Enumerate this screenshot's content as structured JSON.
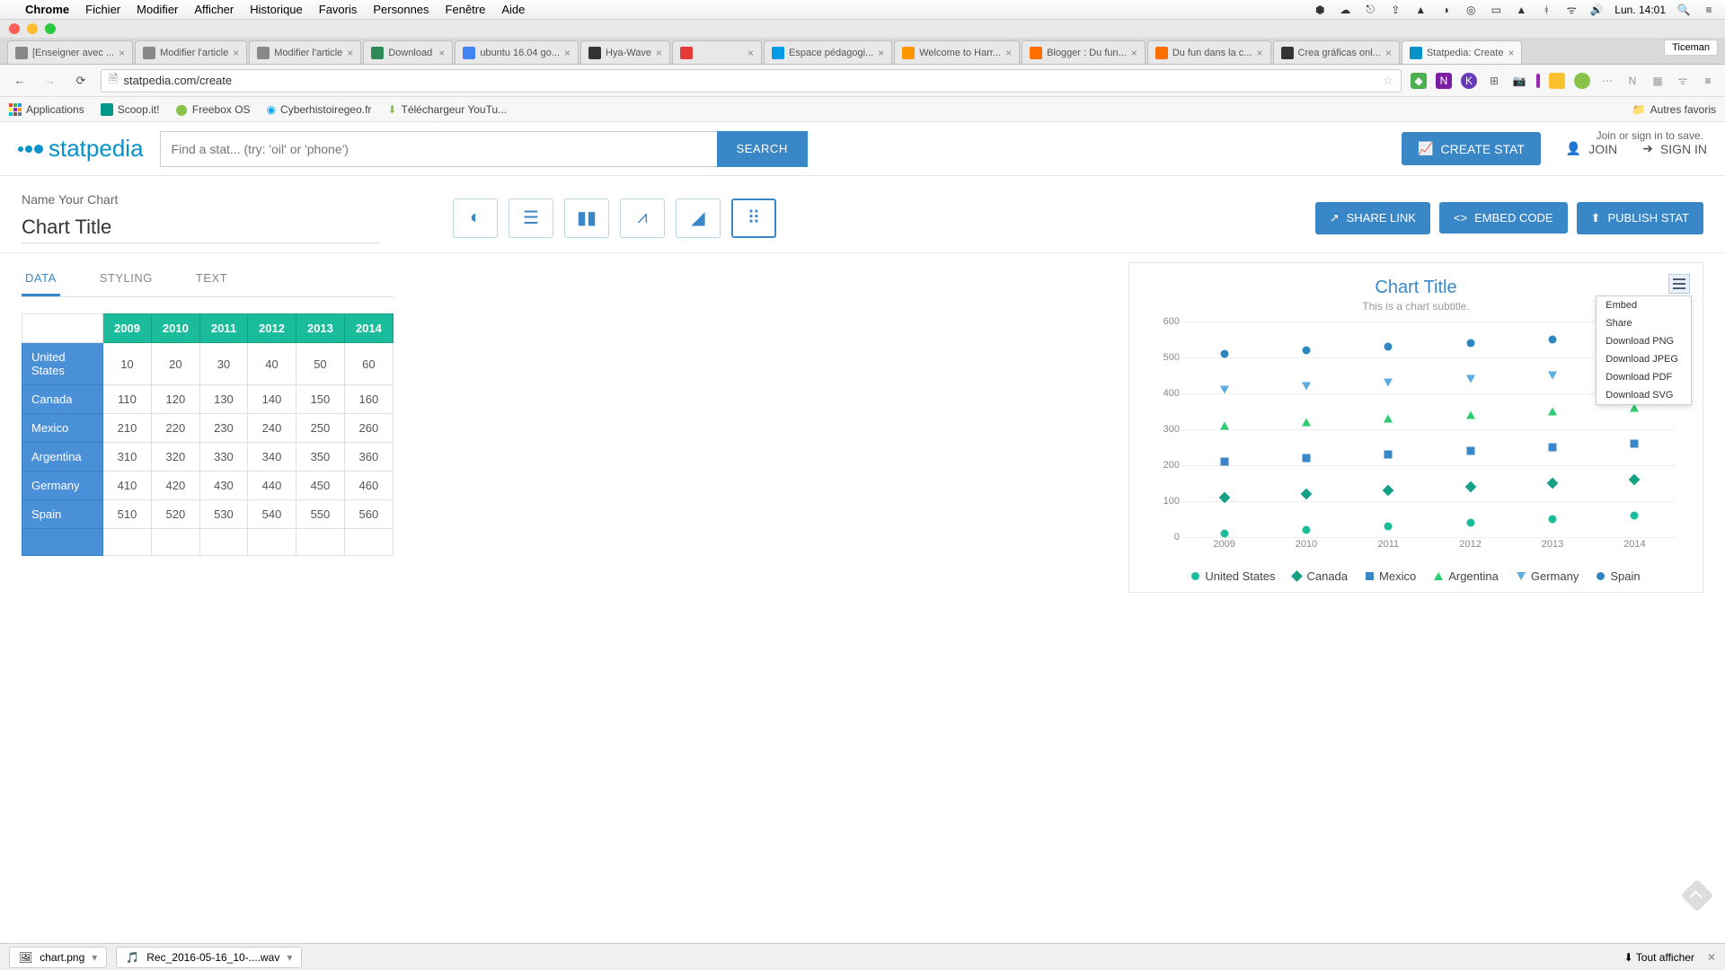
{
  "mac_menu": {
    "app": "Chrome",
    "items": [
      "Fichier",
      "Modifier",
      "Afficher",
      "Historique",
      "Favoris",
      "Personnes",
      "Fenêtre",
      "Aide"
    ],
    "clock": "Lun. 14:01"
  },
  "chrome": {
    "user_badge": "Ticeman",
    "tabs": [
      {
        "label": "[Enseigner avec ...",
        "favcolor": "#888"
      },
      {
        "label": "Modifier l'article",
        "favcolor": "#888"
      },
      {
        "label": "Modifier l'article",
        "favcolor": "#888"
      },
      {
        "label": "Download",
        "favcolor": "#2e8b57"
      },
      {
        "label": "ubuntu 16.04 go...",
        "favcolor": "#4285f4"
      },
      {
        "label": "Hya-Wave",
        "favcolor": "#333"
      },
      {
        "label": "",
        "favcolor": "#e53935"
      },
      {
        "label": "Espace pédagogi...",
        "favcolor": "#039be5"
      },
      {
        "label": "Welcome to Harr...",
        "favcolor": "#ff9800"
      },
      {
        "label": "Blogger : Du fun...",
        "favcolor": "#ff6f00"
      },
      {
        "label": "Du fun dans la c...",
        "favcolor": "#ff6f00"
      },
      {
        "label": "Crea gráficas onl...",
        "favcolor": "#333"
      },
      {
        "label": "Statpedia: Create",
        "favcolor": "#0693c9",
        "active": true
      }
    ],
    "url": "statpedia.com/create",
    "bookmarks": [
      {
        "label": "Applications",
        "color": "#f44336"
      },
      {
        "label": "Scoop.it!",
        "color": "#009688"
      },
      {
        "label": "Freebox OS",
        "color": "#8bc34a"
      },
      {
        "label": "Cyberhistoiregeo.fr",
        "color": "#03a9f4"
      },
      {
        "label": "Téléchargeur YouTu...",
        "color": "#8bc34a"
      }
    ],
    "bookmarks_right": "Autres favoris"
  },
  "header": {
    "logo_text": "statpedia",
    "search_placeholder": "Find a stat... (try: 'oil' or 'phone')",
    "search_btn": "SEARCH",
    "create_stat": "CREATE STAT",
    "join": "JOIN",
    "signin": "SIGN IN"
  },
  "toolbar": {
    "name_label": "Name Your Chart",
    "chart_title_value": "Chart Title",
    "save_hint": "Join or sign in to save.",
    "share_link": "SHARE LINK",
    "embed_code": "EMBED CODE",
    "publish_stat": "PUBLISH STAT",
    "chart_types": [
      "pie",
      "hbar",
      "vbar",
      "line",
      "area",
      "scatter"
    ],
    "selected_type_index": 5
  },
  "tabs": {
    "data": "DATA",
    "styling": "STYLING",
    "text": "TEXT",
    "active": "data"
  },
  "table": {
    "years": [
      "2009",
      "2010",
      "2011",
      "2012",
      "2013",
      "2014"
    ],
    "rows": [
      {
        "name": "United States",
        "vals": [
          10,
          20,
          30,
          40,
          50,
          60
        ]
      },
      {
        "name": "Canada",
        "vals": [
          110,
          120,
          130,
          140,
          150,
          160
        ]
      },
      {
        "name": "Mexico",
        "vals": [
          210,
          220,
          230,
          240,
          250,
          260
        ]
      },
      {
        "name": "Argentina",
        "vals": [
          310,
          320,
          330,
          340,
          350,
          360
        ]
      },
      {
        "name": "Germany",
        "vals": [
          410,
          420,
          430,
          440,
          450,
          460
        ]
      },
      {
        "name": "Spain",
        "vals": [
          510,
          520,
          530,
          540,
          550,
          560
        ]
      }
    ]
  },
  "chart_preview": {
    "title": "Chart Title",
    "subtitle": "This is a chart subtitle.",
    "menu_items": [
      "Embed",
      "Share",
      "Download PNG",
      "Download JPEG",
      "Download PDF",
      "Download SVG"
    ]
  },
  "chart_data": {
    "type": "scatter",
    "title": "Chart Title",
    "subtitle": "This is a chart subtitle.",
    "xlabel": "",
    "ylabel": "",
    "x_categories": [
      "2009",
      "2010",
      "2011",
      "2012",
      "2013",
      "2014"
    ],
    "ylim": [
      0,
      600
    ],
    "y_ticks": [
      0,
      100,
      200,
      300,
      400,
      500,
      600
    ],
    "series": [
      {
        "name": "United States",
        "marker": "circle",
        "color": "#1abc9c",
        "values": [
          10,
          20,
          30,
          40,
          50,
          60
        ]
      },
      {
        "name": "Canada",
        "marker": "diamond",
        "color": "#16a085",
        "values": [
          110,
          120,
          130,
          140,
          150,
          160
        ]
      },
      {
        "name": "Mexico",
        "marker": "square",
        "color": "#3a87c7",
        "values": [
          210,
          220,
          230,
          240,
          250,
          260
        ]
      },
      {
        "name": "Argentina",
        "marker": "triangle-up",
        "color": "#2ecc71",
        "values": [
          310,
          320,
          330,
          340,
          350,
          360
        ]
      },
      {
        "name": "Germany",
        "marker": "triangle-down",
        "color": "#5dade2",
        "values": [
          410,
          420,
          430,
          440,
          450,
          460
        ]
      },
      {
        "name": "Spain",
        "marker": "circle",
        "color": "#2e86c1",
        "values": [
          510,
          520,
          530,
          540,
          550,
          560
        ]
      }
    ]
  },
  "downloads": {
    "items": [
      {
        "name": "chart.png"
      },
      {
        "name": "Rec_2016-05-16_10-....wav"
      }
    ],
    "show_all": "Tout afficher"
  }
}
